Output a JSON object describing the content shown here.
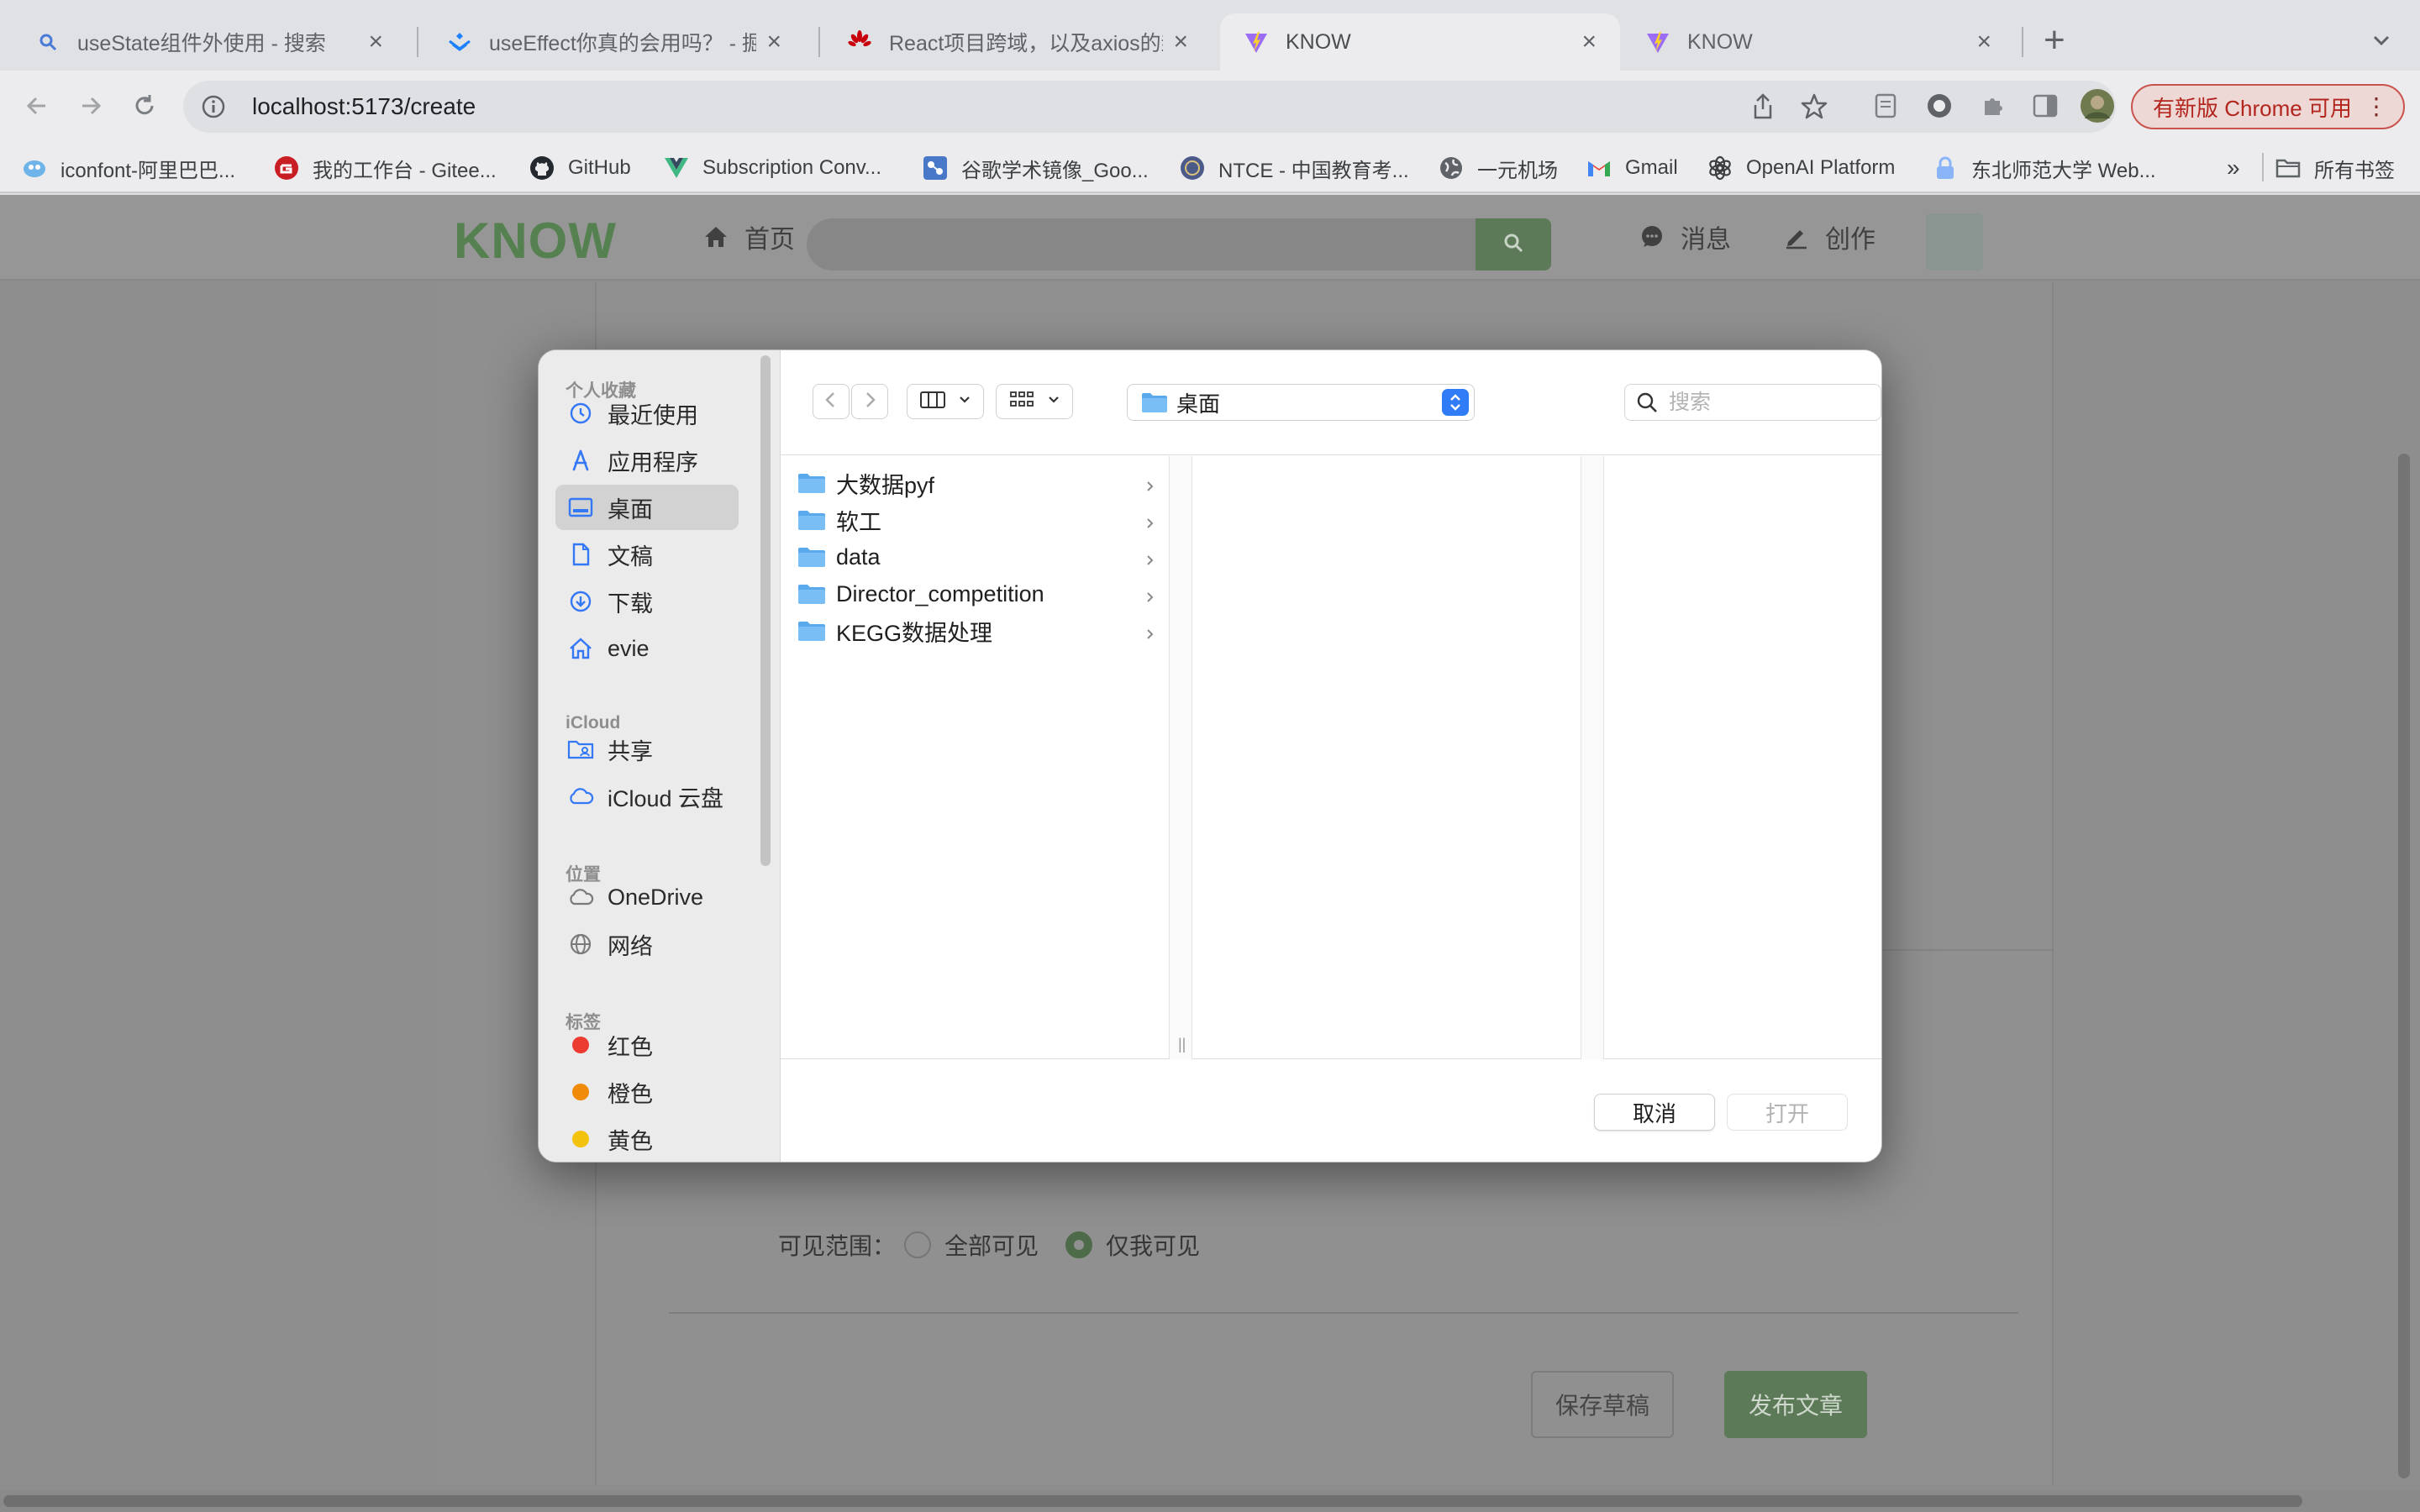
{
  "browser": {
    "tabs": [
      {
        "title": "useState组件外使用 - 搜索",
        "icon": "search-icon"
      },
      {
        "title": "useEffect你真的会用吗？ - 掘金",
        "icon": "juejin-icon"
      },
      {
        "title": "React项目跨域，以及axios的封装",
        "icon": "huawei-icon"
      },
      {
        "title": "KNOW",
        "icon": "vite-icon",
        "active": true
      },
      {
        "title": "KNOW",
        "icon": "vite-icon"
      }
    ],
    "url": "localhost:5173/create",
    "update_chip": "有新版 Chrome 可用",
    "bookmarks": [
      {
        "label": "iconfont-阿里巴巴...",
        "icon": "iconfont-icon"
      },
      {
        "label": "我的工作台 - Gitee...",
        "icon": "gitee-icon"
      },
      {
        "label": "GitHub",
        "icon": "github-icon"
      },
      {
        "label": "Subscription Conv...",
        "icon": "vue-icon"
      },
      {
        "label": "谷歌学术镜像_Goo...",
        "icon": "scholar-icon"
      },
      {
        "label": "NTCE - 中国教育考...",
        "icon": "ntce-icon"
      },
      {
        "label": "一元机场",
        "icon": "globe-icon"
      },
      {
        "label": "Gmail",
        "icon": "gmail-icon"
      },
      {
        "label": "OpenAI Platform",
        "icon": "openai-icon"
      },
      {
        "label": "东北师范大学 Web...",
        "icon": "lock-icon"
      }
    ],
    "all_bookmarks": "所有书签",
    "more_bookmarks": "»"
  },
  "site": {
    "logo": "KNOW",
    "nav_home": "首页",
    "nav_messages": "消息",
    "nav_create": "创作",
    "visibility_label": "可见范围：",
    "visibility_all": "全部可见",
    "visibility_me": "仅我可见",
    "visibility_selected": "仅我可见",
    "save_draft": "保存草稿",
    "publish": "发布文章"
  },
  "dialog": {
    "sidebar": {
      "favorites_title": "个人收藏",
      "favorites": [
        {
          "label": "最近使用",
          "icon": "clock-icon"
        },
        {
          "label": "应用程序",
          "icon": "applications-icon"
        },
        {
          "label": "桌面",
          "icon": "desktop-icon",
          "selected": true
        },
        {
          "label": "文稿",
          "icon": "document-icon"
        },
        {
          "label": "下载",
          "icon": "download-icon"
        },
        {
          "label": "evie",
          "icon": "home-icon"
        }
      ],
      "icloud_title": "iCloud",
      "icloud": [
        {
          "label": "共享",
          "icon": "shared-folder-icon"
        },
        {
          "label": "iCloud 云盘",
          "icon": "cloud-icon"
        }
      ],
      "locations_title": "位置",
      "locations": [
        {
          "label": "OneDrive",
          "icon": "cloud-icon"
        },
        {
          "label": "网络",
          "icon": "network-icon"
        }
      ],
      "tags_title": "标签",
      "tags": [
        {
          "label": "红色",
          "color": "#ec3b31"
        },
        {
          "label": "橙色",
          "color": "#f08a09"
        },
        {
          "label": "黄色",
          "color": "#f3c20d"
        }
      ]
    },
    "current_folder": "桌面",
    "search_placeholder": "搜索",
    "files": [
      "大数据pyf",
      "软工",
      "data",
      "Director_competition",
      "KEGG数据处理"
    ],
    "cancel": "取消",
    "open": "打开"
  },
  "colors": {
    "accent_green": "#5d7a58",
    "mac_blue": "#2f7cf6",
    "folder_blue": "#6cb8f0"
  }
}
